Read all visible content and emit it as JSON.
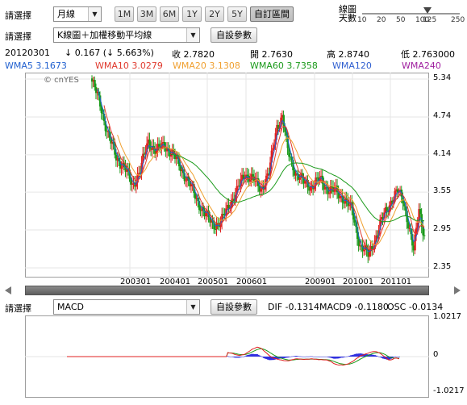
{
  "toolbar": {
    "selector_label": "請選擇",
    "period_value": "月線",
    "ranges": [
      "1M",
      "3M",
      "6M",
      "1Y",
      "2Y",
      "5Y",
      "自訂區間"
    ],
    "active_range": "自訂區間",
    "slider_title": "線圖\n天數",
    "slider_labels": [
      "10",
      "20",
      "50",
      "100",
      "125",
      "250"
    ],
    "slider_value": "125"
  },
  "indicator_row": {
    "selector_label": "請選擇",
    "chart_type_value": "K線圖＋加權移動平均線",
    "settings_button": "自設參數"
  },
  "quote": {
    "date": "20120301",
    "change": "↓ 0.167 (↓ 5.663%)",
    "close": "收 2.7820",
    "open": "開 2.7630",
    "high": "高 2.8740",
    "low": "低 2.763000"
  },
  "ma_legend": [
    {
      "label": "WMA5 3.1673",
      "color": "#1f5fcf"
    },
    {
      "label": "WMA10 3.0279",
      "color": "#e03a2e"
    },
    {
      "label": "WMA20 3.1308",
      "color": "#f0a030"
    },
    {
      "label": "WMA60 3.7358",
      "color": "#1a9a1a"
    },
    {
      "label": "WMA120",
      "color": "#2f5fd0"
    },
    {
      "label": "WMA240",
      "color": "#a020a0"
    }
  ],
  "watermark": "© cnYES",
  "price_axis": [
    "5.34",
    "4.74",
    "4.14",
    "3.55",
    "2.95",
    "2.35"
  ],
  "time_axis": [
    "200301",
    "200401",
    "200501",
    "200601",
    "200901",
    "201001",
    "201101"
  ],
  "scroll": {
    "left_arrow": "◀",
    "right_arrow": "▶"
  },
  "macd_row": {
    "selector_label": "請選擇",
    "indicator_value": "MACD",
    "settings_button": "自設參數",
    "dif": "DIF -0.1314",
    "macd9": "MACD9 -0.1180",
    "osc": "OSC -0.0134"
  },
  "macd_axis": [
    "1.0217",
    "0",
    "-1.0217"
  ],
  "colors": {
    "up": "#e02020",
    "down": "#1a9a1a",
    "histogram": "#3030e0"
  }
}
